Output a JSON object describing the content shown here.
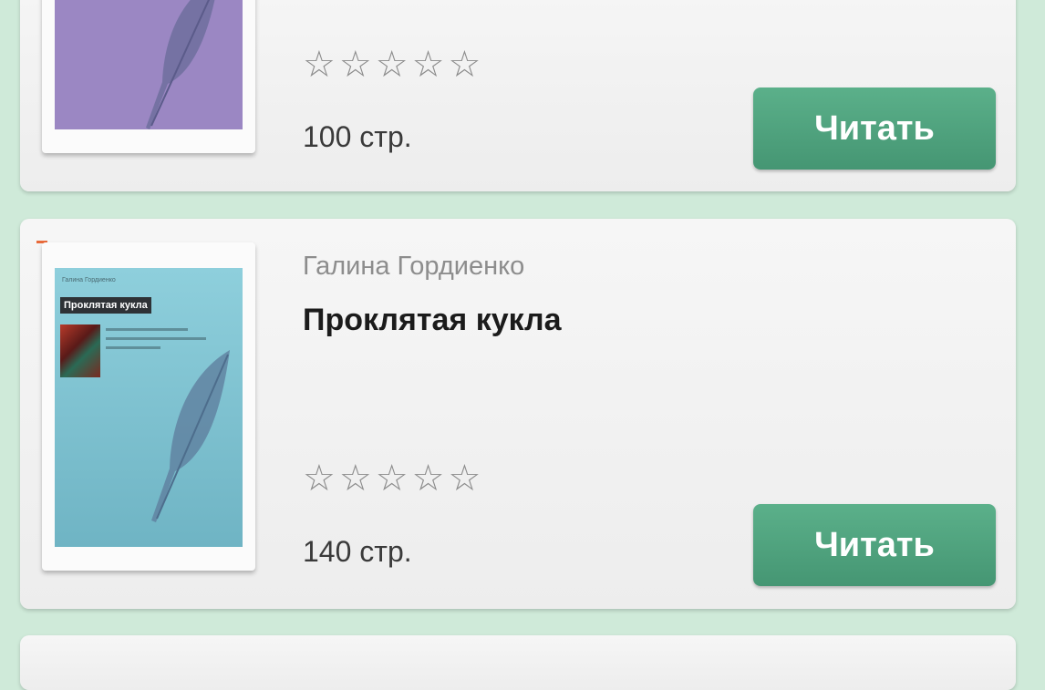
{
  "books": [
    {
      "author": "",
      "title": "",
      "rating_stars": "☆☆☆☆☆",
      "pages": "100 стр.",
      "read_label": "Читать",
      "cover_color": "#9b87c3"
    },
    {
      "author": "Галина Гордиенко",
      "title": "Проклятая кукла",
      "rating_stars": "☆☆☆☆☆",
      "pages": "140 стр.",
      "read_label": "Читать",
      "cover_color": "#7fc3d1"
    }
  ],
  "colors": {
    "background": "#cfead9",
    "button": "#4fa37e"
  },
  "icons": {
    "cover_art": "feather-icon",
    "rating": "star-outline-icon"
  }
}
